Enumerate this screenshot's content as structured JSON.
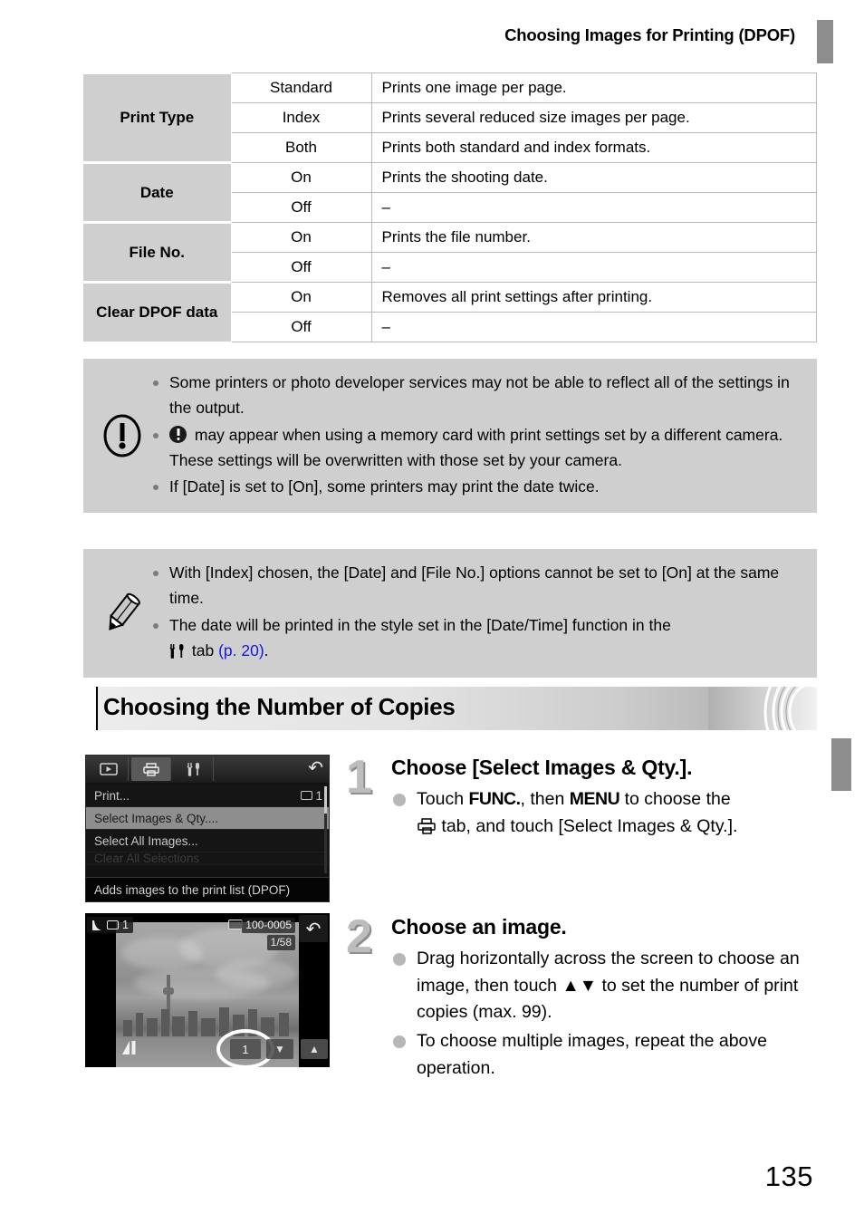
{
  "header": {
    "title": "Choosing Images for Printing (DPOF)"
  },
  "spec_table": {
    "rows": [
      {
        "category": "Print Type",
        "rowspan": 3,
        "option": "Standard",
        "description": "Prints one image per page."
      },
      {
        "category": "",
        "rowspan": 0,
        "option": "Index",
        "description": "Prints several reduced size images per page."
      },
      {
        "category": "",
        "rowspan": 0,
        "option": "Both",
        "description": "Prints both standard and index formats."
      },
      {
        "category": "Date",
        "rowspan": 2,
        "option": "On",
        "description": "Prints the shooting date."
      },
      {
        "category": "",
        "rowspan": 0,
        "option": "Off",
        "description": "–"
      },
      {
        "category": "File No.",
        "rowspan": 2,
        "option": "On",
        "description": "Prints the file number."
      },
      {
        "category": "",
        "rowspan": 0,
        "option": "Off",
        "description": "–"
      },
      {
        "category": "Clear DPOF data",
        "rowspan": 2,
        "option": "On",
        "description": "Removes all print settings after printing."
      },
      {
        "category": "",
        "rowspan": 0,
        "option": "Off",
        "description": "–"
      }
    ]
  },
  "warning_box": {
    "icon": "exclamation-circle-icon",
    "items": [
      "Some printers or photo developer services may not be able to reflect all of the settings in the output.",
      " may appear when using a memory card with print settings set by a different camera. These settings will be overwritten with those set by your camera.",
      "If [Date] is set to [On], some printers may print the date twice."
    ]
  },
  "note_box": {
    "icon": "pencil-icon",
    "item1": "With [Index] chosen, the [Date] and [File No.] options cannot be set to [On] at the same time.",
    "item2_pre": "The date will be printed in the style set in the [Date/Time] function in the",
    "item2_tab_glyph": "⅄↑",
    "item2_mid": "tab",
    "item2_link": "(p. 20)",
    "item2_end": "."
  },
  "section": {
    "heading": "Choosing the Number of Copies"
  },
  "steps": [
    {
      "number": "1",
      "title": "Choose [Select Images & Qty.].",
      "bullets": [
        {
          "pre": "Touch ",
          "kw1": "FUNC.",
          "mid": ", then ",
          "kw2": "MENU",
          "post": " to choose the",
          "line2_pre": "",
          "line2_post": " tab, and touch [Select Images & Qty.]."
        }
      ]
    },
    {
      "number": "2",
      "title": "Choose an image.",
      "bullets": [
        {
          "text_pre": "Drag horizontally across the screen to choose an image, then touch ",
          "arrows": "▲▼",
          "text_post": " to set the number of print copies (max. 99)."
        },
        {
          "text_pre": "To choose multiple images, repeat the above operation.",
          "arrows": "",
          "text_post": ""
        }
      ]
    }
  ],
  "camera_screen_1": {
    "tabs": [
      "playback-icon",
      "print-icon",
      "settings-icon"
    ],
    "back_button": "↶",
    "menu_items": [
      {
        "label": "Print...",
        "value": "1",
        "selected": false
      },
      {
        "label": "Select Images & Qty....",
        "value": "",
        "selected": true
      },
      {
        "label": "Select All Images...",
        "value": "",
        "selected": false
      },
      {
        "label": "Clear All Selections",
        "value": "",
        "selected": false
      }
    ],
    "caption": "Adds images to the print list (DPOF)"
  },
  "camera_screen_2": {
    "print_count_badge": "1",
    "file_number": "100-0005",
    "frame_counter": "1/58",
    "quantity": "1",
    "arrow_down": "▼",
    "arrow_up": "▲",
    "back_button": "↶",
    "quality_icon": "image-quality-icon"
  },
  "page_number": "135",
  "colors": {
    "table_header_bg": "#cfcfcf",
    "callout_bg": "#cfcfcf",
    "side_tab": "#8d8d8d",
    "link": "#1717d8",
    "step_number": "#bdbdbd"
  }
}
